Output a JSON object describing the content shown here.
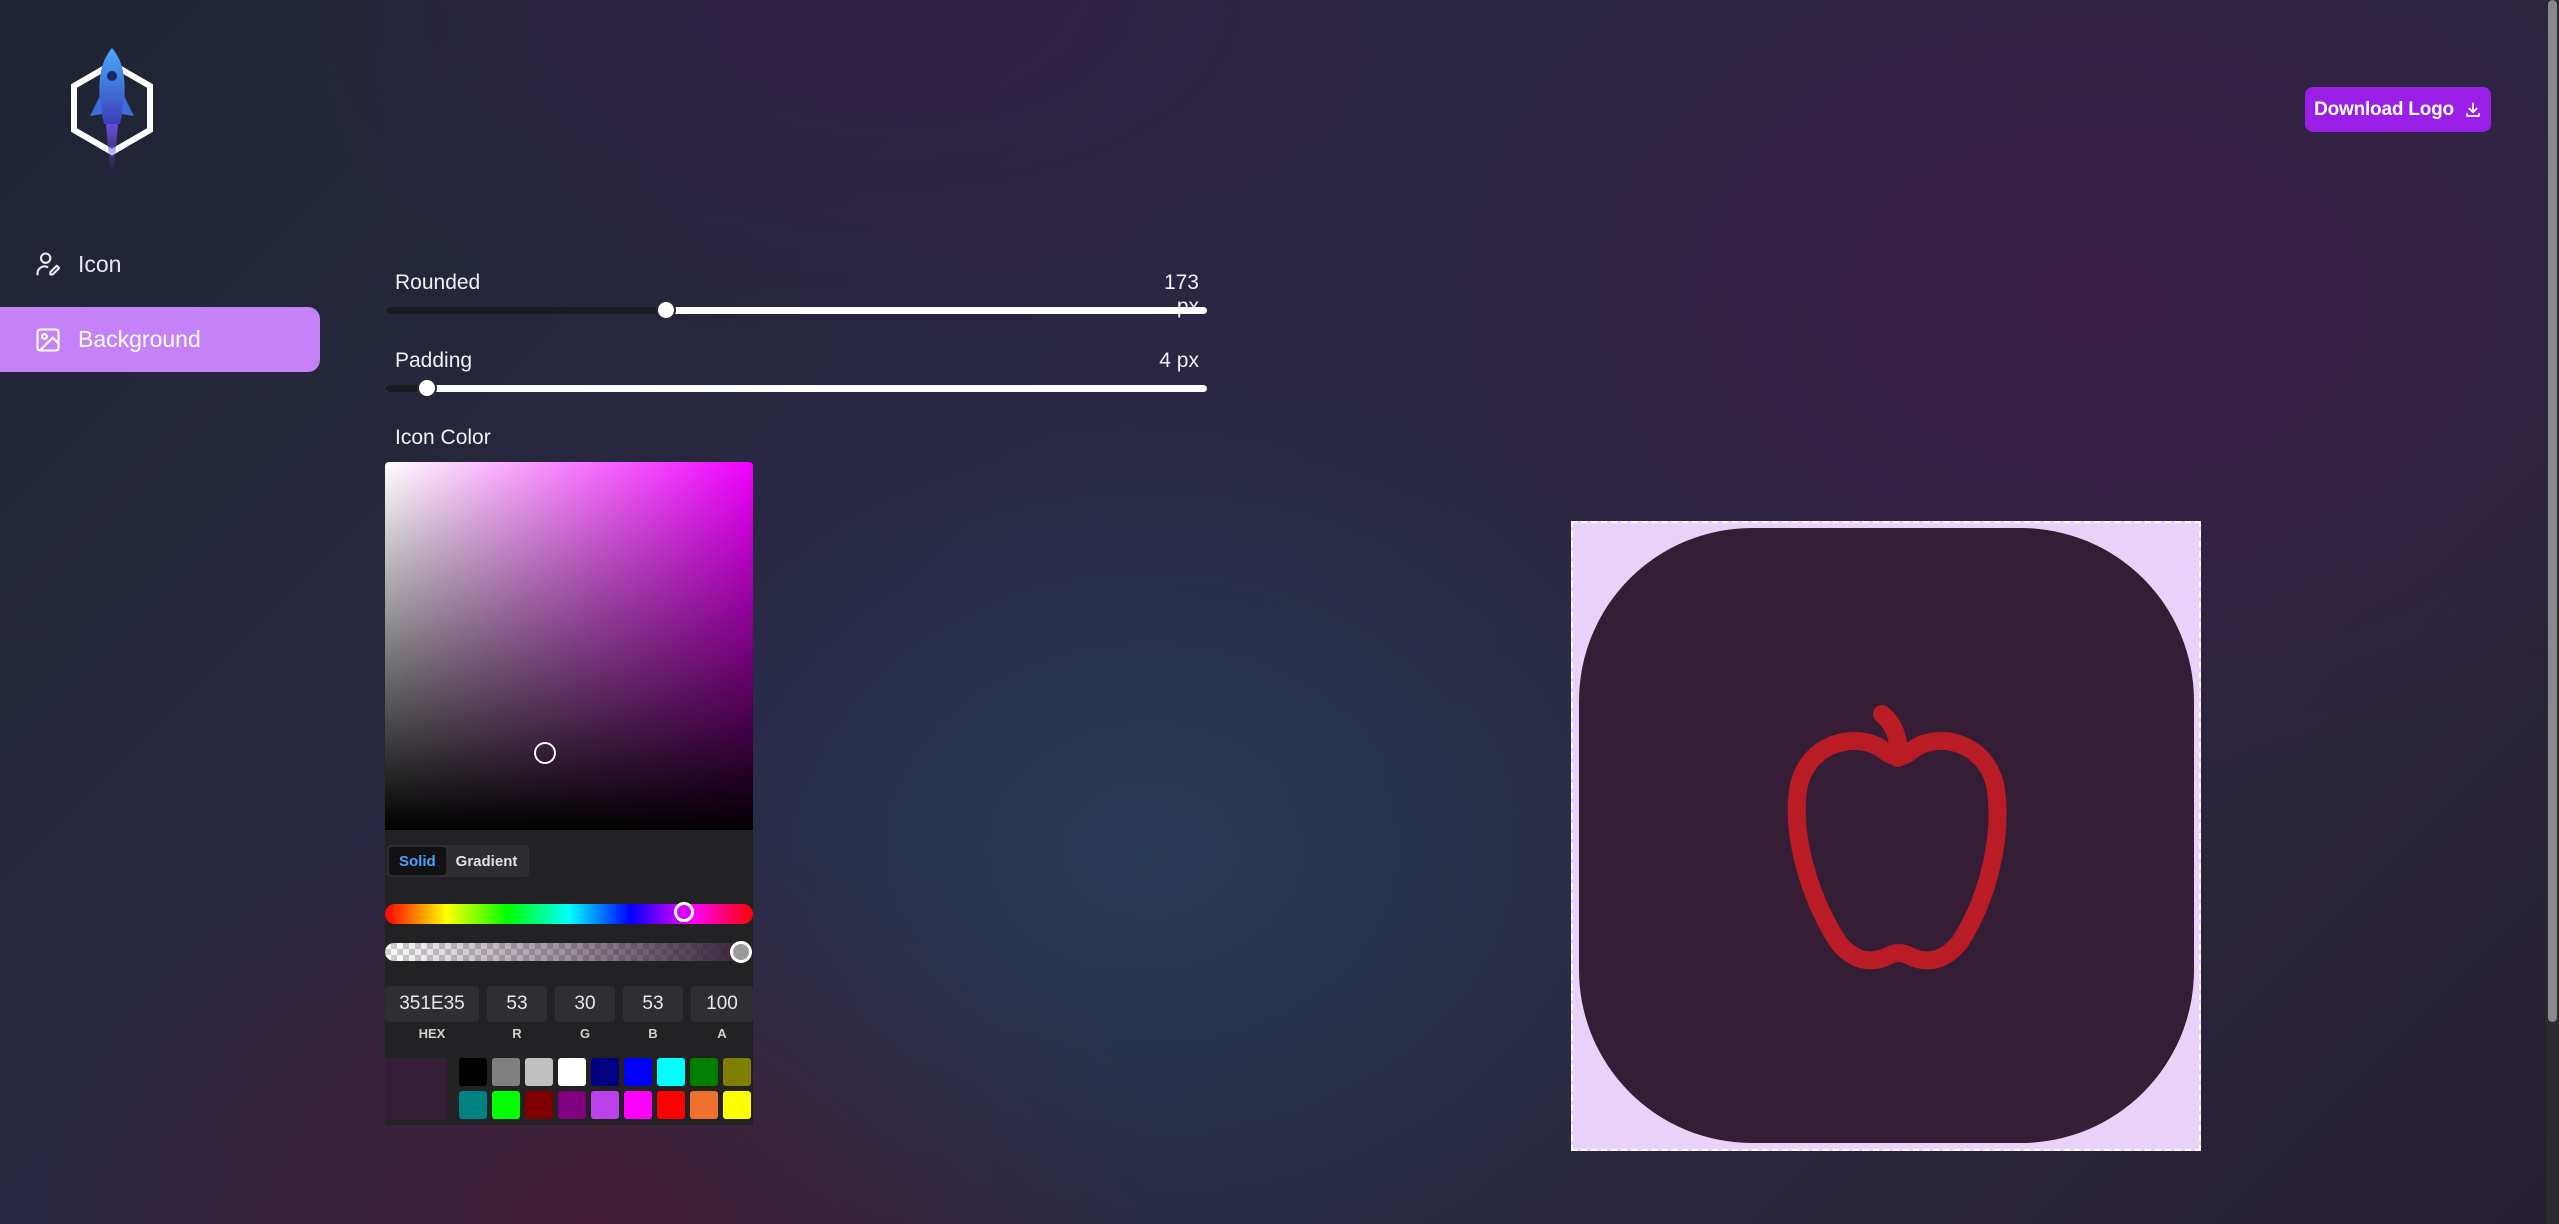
{
  "header": {
    "logo_icon": "rocket-hexagon-logo",
    "download_label": "Download Logo",
    "download_icon": "download-icon"
  },
  "sidebar": {
    "items": [
      {
        "label": "Icon",
        "icon": "user-pen-icon",
        "active": false
      },
      {
        "label": "Background",
        "icon": "image-icon",
        "active": true
      }
    ]
  },
  "controls": {
    "rounded": {
      "label": "Rounded",
      "value_text": "173 px",
      "value": 173,
      "fraction": 0.34
    },
    "padding": {
      "label": "Padding",
      "value_text": "4 px",
      "value": 4,
      "fraction": 0.05
    },
    "icon_color_label": "Icon Color"
  },
  "color_picker": {
    "modes": [
      "Solid",
      "Gradient"
    ],
    "active_mode": "Solid",
    "hue_fraction": 0.79,
    "alpha_fraction": 1.0,
    "fields": [
      {
        "label": "HEX",
        "value": "351E35"
      },
      {
        "label": "R",
        "value": "53"
      },
      {
        "label": "G",
        "value": "30"
      },
      {
        "label": "B",
        "value": "53"
      },
      {
        "label": "A",
        "value": "100"
      }
    ],
    "current_color": "#351E35",
    "presets": [
      "#000000",
      "#808080",
      "#c0c0c0",
      "#ffffff",
      "#000080",
      "#0000ff",
      "#00ffff",
      "#008000",
      "#808000",
      "#008080",
      "#00ff00",
      "#800000",
      "#800080",
      "#b941ea",
      "#ff00ff",
      "#ff0000",
      "#f07030",
      "#ffff00"
    ]
  },
  "preview": {
    "canvas_bg": "#e8d2f9",
    "shape_color": "#351E35",
    "icon": "apple-icon",
    "icon_color": "#b91c24"
  },
  "colors": {
    "accent": "#9a1fe6",
    "active_nav": "#c581f7"
  }
}
